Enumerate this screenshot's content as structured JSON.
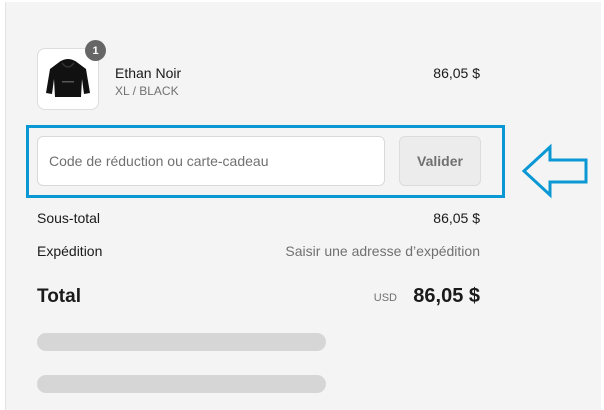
{
  "cart": {
    "items": [
      {
        "quantity": "1",
        "name": "Ethan Noir",
        "variant": "XL / BLACK",
        "price": "86,05 $"
      }
    ]
  },
  "discount": {
    "placeholder": "Code de réduction ou carte-cadeau",
    "value": "",
    "apply_label": "Valider"
  },
  "summary": {
    "subtotal_label": "Sous-total",
    "subtotal_value": "86,05 $",
    "shipping_label": "Expédition",
    "shipping_value": "Saisir une adresse d’expédition",
    "total_label": "Total",
    "currency": "USD",
    "total_value": "86,05 $"
  },
  "annotation": {
    "highlight_color": "#0a98d4",
    "arrow_icon": "arrow-left-outline-icon"
  }
}
